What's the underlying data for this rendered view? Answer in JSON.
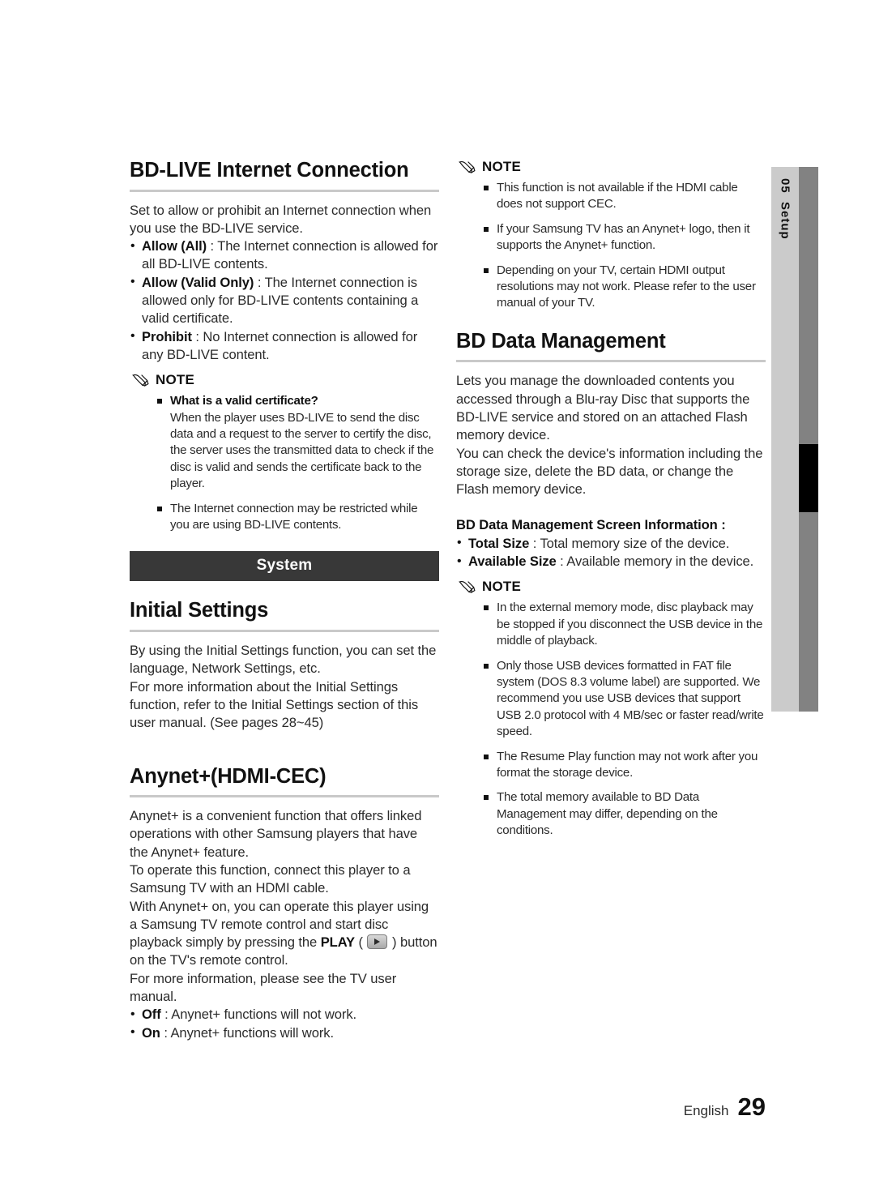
{
  "page": {
    "chapter_number": "05",
    "chapter_label": "Setup",
    "footer_language": "English",
    "footer_page_number": "29",
    "colors": {
      "banner_bg": "#383838",
      "rule": "#c9c9c9",
      "tab_light": "#cbcbcb",
      "tab_dark": "#828282"
    }
  },
  "left_column": {
    "section1": {
      "heading": "BD-LIVE Internet Connection",
      "intro": "Set to allow or prohibit an Internet connection when you use the BD-LIVE service.",
      "options": [
        {
          "term": "Allow (All)",
          "sep": " : ",
          "desc": "The Internet connection is allowed for all BD-LIVE contents."
        },
        {
          "term": "Allow (Valid Only)",
          "sep": " : ",
          "desc": "The Internet connection is allowed only for BD-LIVE contents containing a valid certificate."
        },
        {
          "term": "Prohibit",
          "sep": " : ",
          "desc": "No Internet connection is allowed for any BD-LIVE content."
        }
      ],
      "note": {
        "label": "NOTE",
        "icon": "pencil-icon",
        "items": [
          {
            "question": "What is a valid certificate?",
            "text": "When the player uses BD-LIVE to send the disc data and a request to the server to certify the disc, the server uses the transmitted data to check if the disc is valid and sends the certificate back to the player."
          },
          {
            "question": "",
            "text": "The Internet connection may be restricted while you are using BD-LIVE contents."
          }
        ]
      }
    },
    "banner": {
      "label": "System"
    },
    "section2": {
      "heading": "Initial Settings",
      "paragraphs": [
        "By using the Initial Settings function, you can set the language, Network Settings, etc.",
        "For more information about the Initial Settings function, refer to the Initial Settings section of this user manual. (See pages 28~45)"
      ]
    },
    "section3": {
      "heading": "Anynet+(HDMI-CEC)",
      "paragraphs": [
        "Anynet+ is a convenient function that offers linked operations with other Samsung players that have the Anynet+ feature.",
        "To operate this function, connect this player to a Samsung TV with an HDMI cable."
      ],
      "play_paragraph": {
        "before": "With Anynet+ on, you can operate this player using a Samsung TV remote control and start disc playback simply by pressing the ",
        "key_label": "PLAY",
        "open_paren": " ( ",
        "key_icon": "play-button-icon",
        "close_paren": " ) ",
        "after": "button on the TV's remote control."
      },
      "tail_paragraph": "For more information, please see the TV user manual.",
      "options": [
        {
          "term": "Off",
          "sep": " : ",
          "desc": "Anynet+ functions will not work."
        },
        {
          "term": "On",
          "sep": " : ",
          "desc": "Anynet+ functions will work."
        }
      ]
    }
  },
  "right_column": {
    "note_top": {
      "label": "NOTE",
      "icon": "pencil-icon",
      "items": [
        {
          "question": "",
          "text": "This function is not available if the HDMI cable does not support CEC."
        },
        {
          "question": "",
          "text": "If your Samsung TV has an Anynet+ logo, then it supports the Anynet+ function."
        },
        {
          "question": "",
          "text": "Depending on your TV, certain HDMI output resolutions may not work. Please refer to the user manual of your TV."
        }
      ]
    },
    "section1": {
      "heading": "BD Data Management",
      "paragraphs": [
        "Lets you manage the downloaded contents you accessed through a Blu-ray Disc that supports the BD-LIVE service and stored on an attached Flash memory device.",
        "You can check the device's information including the storage size, delete the BD data, or change the Flash memory device."
      ],
      "screen_info_title": "BD Data Management Screen Information :",
      "options": [
        {
          "term": "Total Size",
          "sep": " : ",
          "desc": "Total memory size of the device."
        },
        {
          "term": "Available Size",
          "sep": " : ",
          "desc": "Available memory in the device."
        }
      ],
      "note": {
        "label": "NOTE",
        "icon": "pencil-icon",
        "items": [
          {
            "question": "",
            "text": "In the external memory mode, disc playback may be stopped if you disconnect the USB device in the middle of playback."
          },
          {
            "question": "",
            "text": "Only those USB devices formatted in FAT file system (DOS 8.3 volume label) are supported. We recommend you use USB devices that support USB 2.0 protocol with 4 MB/sec or faster read/write speed."
          },
          {
            "question": "",
            "text": "The Resume Play function may not work after you format the storage device."
          },
          {
            "question": "",
            "text": "The total memory available to BD Data Management may differ, depending on the conditions."
          }
        ]
      }
    }
  }
}
